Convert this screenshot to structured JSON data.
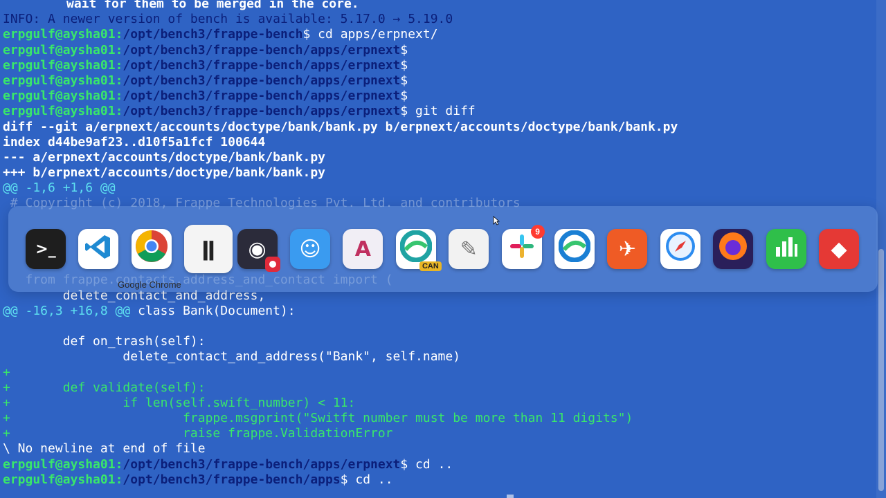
{
  "terminal": {
    "top_partial": "wait for them to be merged in the core.",
    "info_line": "INFO: A newer version of bench is available: 5.17.0 → 5.19.0",
    "user_host": "erpgulf@aysha01",
    "colon": ":",
    "prompts": [
      {
        "path": "/opt/bench3/frappe-bench",
        "sign": "$",
        "cmd": " cd apps/erpnext/"
      },
      {
        "path": "/opt/bench3/frappe-bench/apps/erpnext",
        "sign": "$",
        "cmd": ""
      },
      {
        "path": "/opt/bench3/frappe-bench/apps/erpnext",
        "sign": "$",
        "cmd": ""
      },
      {
        "path": "/opt/bench3/frappe-bench/apps/erpnext",
        "sign": "$",
        "cmd": ""
      },
      {
        "path": "/opt/bench3/frappe-bench/apps/erpnext",
        "sign": "$",
        "cmd": ""
      },
      {
        "path": "/opt/bench3/frappe-bench/apps/erpnext",
        "sign": "$",
        "cmd": " git diff"
      }
    ],
    "diff_header": "diff --git a/erpnext/accounts/doctype/bank/bank.py b/erpnext/accounts/doctype/bank/bank.py",
    "index_line": "index d44be9af23..d10f5a1fcf 100644",
    "minus_file": "--- a/erpnext/accounts/doctype/bank/bank.py",
    "plus_file": "+++ b/erpnext/accounts/doctype/bank/bank.py",
    "hunk1": "@@ -1,6 +1,6 @@",
    "obscured_1": " # Copyright (c) 2018, Frappe Technologies Pvt. Ltd. and contributors",
    "obscured_2": "   from frappe.contacts.address_and_contact import (",
    "ctx_delete_contact": "        delete_contact_and_address,",
    "hunk2": "@@ -16,3 +16,8 @@",
    "hunk2_ctx": " class Bank(Document):",
    "blank": "",
    "ctx_on_trash": "        def on_trash(self):",
    "ctx_delete_call": "                delete_contact_and_address(\"Bank\", self.name)",
    "add_blank": "+",
    "add_validate": "+       def validate(self):",
    "add_if": "+               if len(self.swift_number) < 11:",
    "add_msgprint": "+                       frappe.msgprint(\"Switft number must be more than 11 digits\")",
    "add_raise": "+                       raise frappe.ValidationError",
    "no_newline": "\\ No newline at end of file",
    "final_prompts": [
      {
        "path": "/opt/bench3/frappe-bench/apps/erpnext",
        "sign": "$",
        "cmd": " cd .."
      },
      {
        "path": "/opt/bench3/frappe-bench/apps",
        "sign": "$",
        "cmd": " cd .."
      }
    ]
  },
  "dock": {
    "hovered_label": "Google Chrome",
    "items": [
      {
        "name": "Terminal",
        "icon": "terminal-icon",
        "glyph": ">_",
        "bg": "#1e1e1e",
        "fg": "#ffffff"
      },
      {
        "name": "Visual Studio Code",
        "icon": "vscode-icon",
        "glyph": "⟨⟩",
        "bg": "#ffffff",
        "fg": "#1f8ad2"
      },
      {
        "name": "Google Chrome",
        "icon": "chrome-icon",
        "glyph": "",
        "bg": "#ffffff",
        "fg": "#000000"
      },
      {
        "name": "Inkscape-like",
        "icon": "tie-icon",
        "glyph": "ǁ",
        "bg": "#f4f4f4",
        "fg": "#222222"
      },
      {
        "name": "OBS",
        "icon": "obs-icon",
        "glyph": "◉",
        "bg": "#2b2b3a",
        "fg": "#ffffff"
      },
      {
        "name": "Finder",
        "icon": "finder-icon",
        "glyph": "☺",
        "bg": "#3a9bf0",
        "fg": "#ffffff"
      },
      {
        "name": "Affinity",
        "icon": "affinity-icon",
        "glyph": "A",
        "bg": "#f1eef5",
        "fg": "#c03060"
      },
      {
        "name": "Microsoft Edge Canary",
        "icon": "edge-canary-icon",
        "glyph": "e",
        "bg": "#ffffff",
        "fg": "#0f8a8a",
        "tag": "CAN"
      },
      {
        "name": "TextEdit",
        "icon": "textedit-icon",
        "glyph": "✎",
        "bg": "#f2f2f2",
        "fg": "#777777"
      },
      {
        "name": "Slack",
        "icon": "slack-icon",
        "glyph": "#",
        "bg": "#ffffff",
        "fg": "#4a154b",
        "badge": "9"
      },
      {
        "name": "Microsoft Edge",
        "icon": "edge-icon",
        "glyph": "e",
        "bg": "#ffffff",
        "fg": "#1a7fd4"
      },
      {
        "name": "Postman",
        "icon": "postman-icon",
        "glyph": "✈",
        "bg": "#ef5b25",
        "fg": "#ffffff"
      },
      {
        "name": "Safari",
        "icon": "safari-icon",
        "glyph": "✦",
        "bg": "#ffffff",
        "fg": "#1e90ff"
      },
      {
        "name": "Firefox",
        "icon": "firefox-icon",
        "glyph": "◕",
        "bg": "#2a1f5a",
        "fg": "#ff8a1f"
      },
      {
        "name": "Numbers",
        "icon": "numbers-icon",
        "glyph": "▮",
        "bg": "#2fbf4a",
        "fg": "#ffffff"
      },
      {
        "name": "AnyDesk",
        "icon": "anydesk-icon",
        "glyph": "◆",
        "bg": "#e53935",
        "fg": "#ffffff"
      }
    ]
  }
}
